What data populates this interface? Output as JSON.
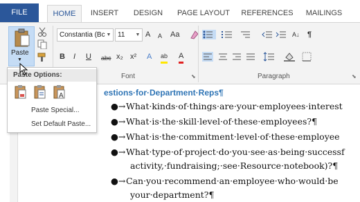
{
  "tabs": [
    "FILE",
    "HOME",
    "INSERT",
    "DESIGN",
    "PAGE LAYOUT",
    "REFERENCES",
    "MAILINGS"
  ],
  "ribbon": {
    "paste_label": "Paste",
    "font_name": "Constantia (Bc",
    "font_size": "11",
    "font_group_label": "Font",
    "paragraph_group_label": "Paragraph",
    "grow_font": "A",
    "shrink_font": "A",
    "change_case": "Aa",
    "bold": "B",
    "italic": "I",
    "underline": "U",
    "strikethrough": "abc",
    "subscript": "x₂",
    "superscript": "x²",
    "text_effects": "A",
    "highlight": "ab",
    "font_color": "A",
    "sort": "A↓",
    "show_marks": "¶"
  },
  "paste_menu": {
    "header": "Paste Options:",
    "items": [
      "Paste Special...",
      "Set Default Paste..."
    ]
  },
  "document": {
    "heading": "estions·for·Department·Reps¶",
    "bullets": [
      "What·kinds·of·things·are·your·employees·interest",
      "What·is·the·skill·level·of·these·employees?¶",
      "What·is·the·commitment·level·of·these·employee",
      "What·type·of·project·do·you·see·as·being·successf",
      "Can·you·recommend·an·employee·who·would·be"
    ],
    "continuations": [
      "activity,·fundraising;·see·Resource·notebook)?¶",
      "your·department?¶"
    ],
    "bullet_glyph": "●→"
  },
  "colors": {
    "accent": "#2b579a",
    "heading": "#2e74b5",
    "pressed": "#c5dcf5"
  }
}
